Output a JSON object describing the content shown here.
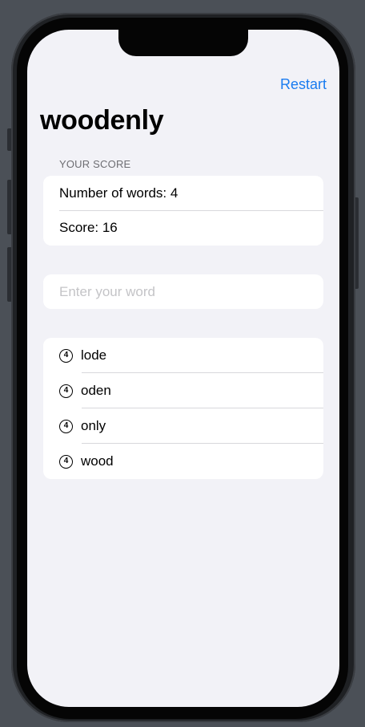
{
  "nav": {
    "restart_label": "Restart"
  },
  "root_word": "woodenly",
  "score_section": {
    "header": "YOUR SCORE",
    "number_of_words": "Number of words: 4",
    "score": "Score: 16"
  },
  "input": {
    "placeholder": "Enter your word",
    "value": ""
  },
  "used_words": [
    {
      "count": "4",
      "word": "lode"
    },
    {
      "count": "4",
      "word": "oden"
    },
    {
      "count": "4",
      "word": "only"
    },
    {
      "count": "4",
      "word": "wood"
    }
  ],
  "colors": {
    "accent": "#1a7cf0",
    "background": "#f2f2f7",
    "card": "#ffffff",
    "section_header": "#6d6d72",
    "placeholder": "#c4c4c7"
  }
}
